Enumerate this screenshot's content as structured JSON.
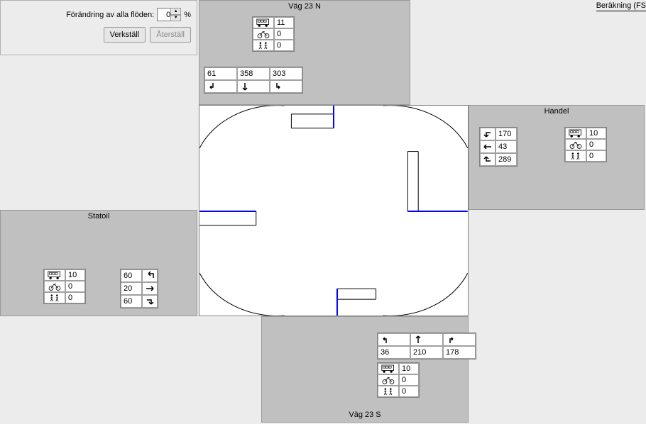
{
  "controls": {
    "label": "Förändring av alla flöden:",
    "value": "0",
    "unit": "%",
    "apply": "Verkställ",
    "reset": "Återställ"
  },
  "calc_link": "Beräkning (FS",
  "north": {
    "title": "Väg 23 N",
    "vehicles": {
      "bus": "11",
      "bike": "0",
      "ped": "0"
    },
    "turns": {
      "left": "61",
      "straight": "358",
      "right": "303"
    }
  },
  "south": {
    "title": "Väg 23 S",
    "vehicles": {
      "bus": "10",
      "bike": "0",
      "ped": "0"
    },
    "turns": {
      "left": "36",
      "straight": "210",
      "right": "178"
    }
  },
  "west": {
    "title": "Statoil",
    "vehicles": {
      "bus": "10",
      "bike": "0",
      "ped": "0"
    },
    "turns": {
      "left": "60",
      "straight": "20",
      "right": "60"
    }
  },
  "east": {
    "title": "Handel",
    "vehicles": {
      "bus": "10",
      "bike": "0",
      "ped": "0"
    },
    "turns": {
      "left": "170",
      "straight": "43",
      "right": "289"
    }
  }
}
